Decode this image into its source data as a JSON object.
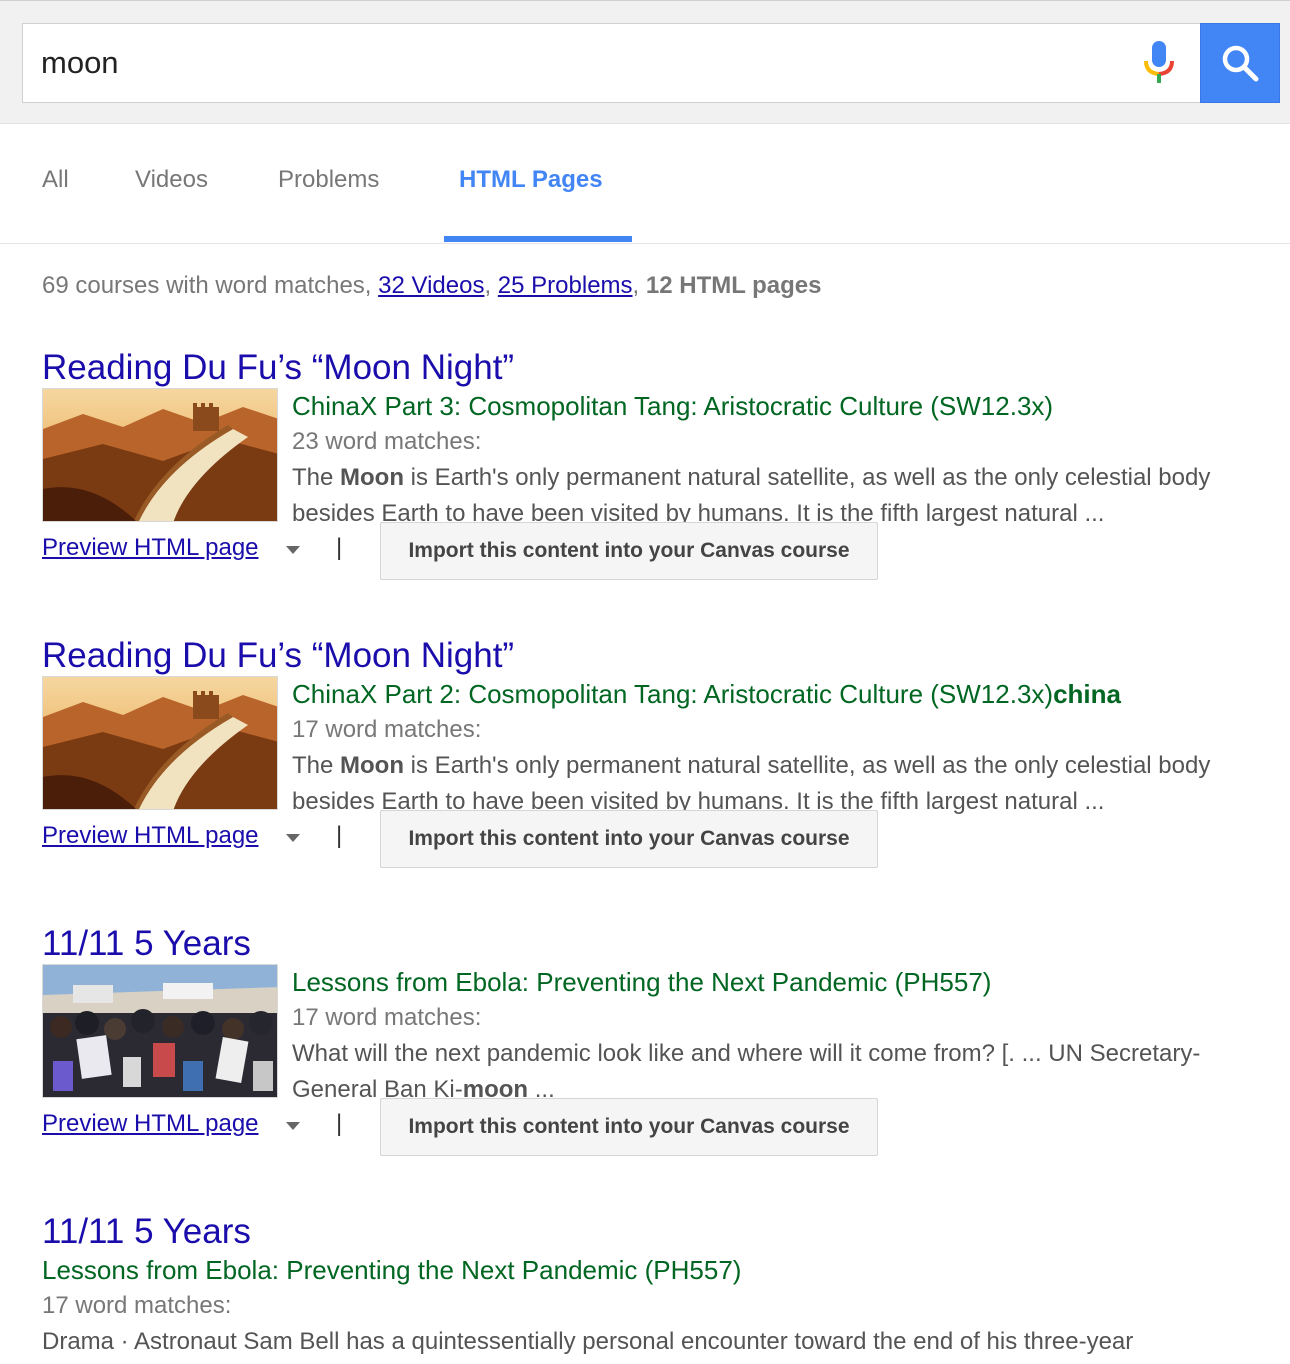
{
  "search": {
    "query": "moon"
  },
  "tabs": [
    {
      "label": "All"
    },
    {
      "label": "Videos"
    },
    {
      "label": "Problems"
    },
    {
      "label": "HTML Pages",
      "active": true
    }
  ],
  "summary": {
    "courses_text": "69 courses with word matches, ",
    "videos_link": "32 Videos",
    "comma1": ", ",
    "problems_link": "25 Problems",
    "comma2": ", ",
    "html_pages": "12 HTML pages"
  },
  "results": [
    {
      "title": "Reading Du Fu’s “Moon Night”",
      "course": "ChinaX Part 3: Cosmopolitan Tang: Aristocratic Culture (SW12.3x)",
      "course_bold": "",
      "count": "23 word matches:",
      "snippet_pre": "The ",
      "snippet_bold": "Moon",
      "snippet_post": " is Earth's only permanent natural satellite, as well as the only celestial body besides Earth to have been visited by humans. It is the fifth largest natural ...",
      "thumbnail": "great-wall-image",
      "preview_label": "Preview HTML page",
      "separator": "|",
      "import_label": "Import this content into your Canvas course"
    },
    {
      "title": "Reading Du Fu’s “Moon Night”",
      "course": "ChinaX Part 2: Cosmopolitan Tang: Aristocratic Culture (SW12.3x)",
      "course_bold": "china",
      "count": "17 word matches:",
      "snippet_pre": "The ",
      "snippet_bold": "Moon",
      "snippet_post": " is Earth's only permanent natural satellite, as well as the only celestial body besides Earth to have been visited by humans. It is the fifth largest natural ...",
      "thumbnail": "great-wall-image",
      "preview_label": "Preview HTML page",
      "separator": "|",
      "import_label": "Import this content into your Canvas course"
    },
    {
      "title": "11/11 5 Years",
      "course": "Lessons from Ebola: Preventing the Next Pandemic (PH557)",
      "course_bold": "",
      "count": "17 word matches:",
      "snippet_pre": "What will the next pandemic look like and where will it come from? [. ... UN Secretary-General Ban Ki-",
      "snippet_bold": "moon",
      "snippet_post": " ...",
      "thumbnail": "crowd-image",
      "preview_label": "Preview HTML page",
      "separator": "|",
      "import_label": "Import this content into your Canvas course"
    },
    {
      "title": "11/11 5 Years",
      "course": "Lessons from Ebola: Preventing the Next Pandemic (PH557)",
      "course_bold": "",
      "count": "17 word matches:",
      "snippet_pre": "Drama · Astronaut Sam Bell has a quintessentially personal encounter toward the end of his three-year",
      "snippet_bold": "",
      "snippet_post": ""
    }
  ],
  "colors": {
    "link": "#1a0dab",
    "course": "#006621",
    "accent": "#4285f4",
    "muted": "#777777"
  },
  "icons": [
    "microphone-icon",
    "search-icon",
    "chevron-down-icon"
  ]
}
